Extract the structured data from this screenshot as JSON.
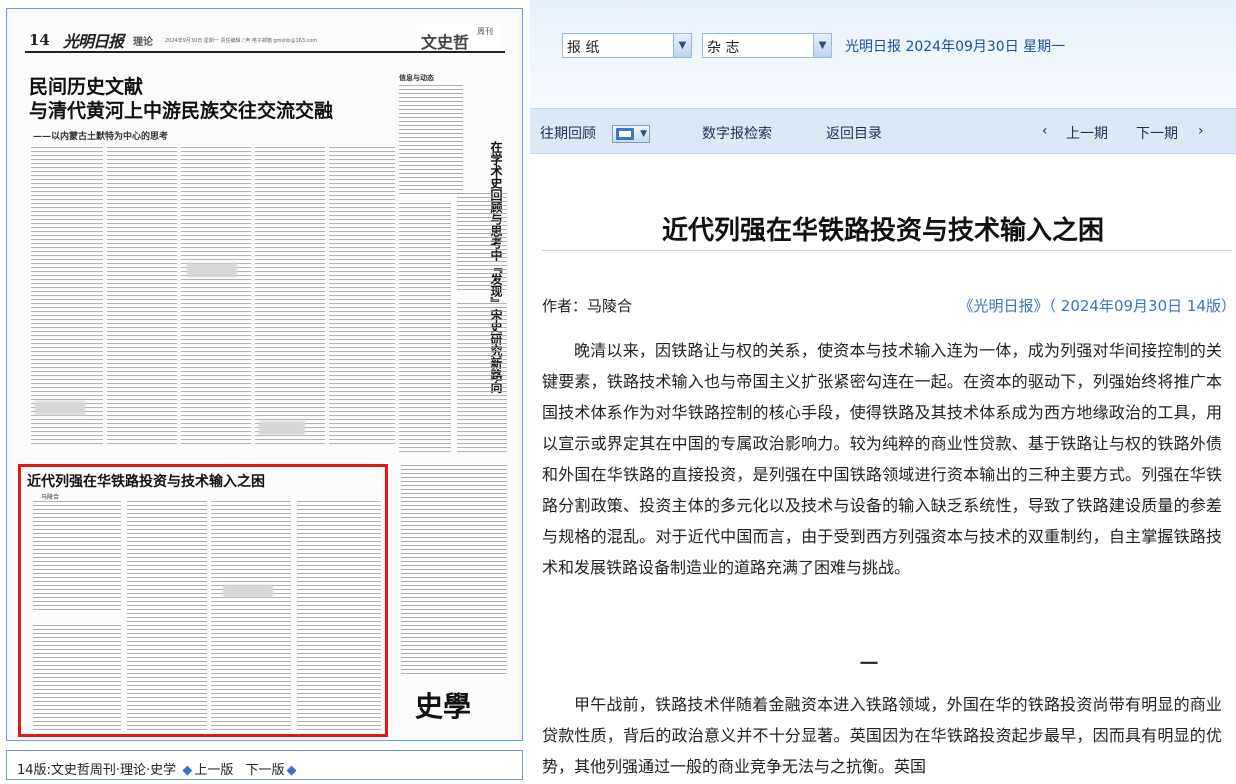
{
  "newspaper": {
    "page_num": "14",
    "logo": "光明日报",
    "section": "理论",
    "meta": "2024年9月30日 星期一 责任编辑 / 声 电子邮箱 gmshb@163.com",
    "weekly_title": "文史哲",
    "weekly_badge": "周刊",
    "headline": [
      "民间历史文献",
      "与清代黄河上中游民族交往交流交融"
    ],
    "subheadline": "——以内蒙古土默特为中心的思考",
    "column_headline": "在学术史回顾与思考中『发现』宋史研究新路向",
    "sidebar_head": "信息与动态",
    "highlight_headline": "近代列强在华铁路投资与技术输入之困",
    "highlight_author": "马陵合",
    "corner_title": "史學"
  },
  "bottom_nav": {
    "page_label": "14版:文史哲周刊·理论·史学",
    "prev": "上一版",
    "next": "下一版"
  },
  "topbar": {
    "select1": "报  纸",
    "select2": "杂  志",
    "date_label": "光明日报  2024年09月30日  星期一"
  },
  "navbar": {
    "history": "往期回顾",
    "search": "数字报检索",
    "back": "返回目录",
    "prev_issue": "上一期",
    "next_issue": "下一期"
  },
  "article": {
    "title": "近代列强在华铁路投资与技术输入之困",
    "author": "作者：马陵合",
    "source": "《光明日报》（ 2024年09月30日  14版）",
    "paragraphs": [
      "晚清以来，因铁路让与权的关系，使资本与技术输入连为一体，成为列强对华间接控制的关键要素，铁路技术输入也与帝国主义扩张紧密勾连在一起。在资本的驱动下，列强始终将推广本国技术体系作为对华铁路控制的核心手段，使得铁路及其技术体系成为西方地缘政治的工具，用以宣示或界定其在中国的专属政治影响力。较为纯粹的商业性贷款、基于铁路让与权的铁路外债和外国在华铁路的直接投资，是列强在中国铁路领域进行资本输出的三种主要方式。列强在华铁路分割政策、投资主体的多元化以及技术与设备的输入缺乏系统性，导致了铁路建设质量的参差与规格的混乱。对于近代中国而言，由于受到西方列强资本与技术的双重制约，自主掌握铁路技术和发展铁路设备制造业的道路充满了困难与挑战。",
      "甲午战前，铁路技术伴随着金融资本进入铁路领域，外国在华的铁路投资尚带有明显的商业贷款性质，背后的政治意义并不十分显著。英国因为在华铁路投资起步最早，因而具有明显的优势，其他列强通过一般的商业竞争无法与之抗衡。英国"
    ],
    "section_numeral": "一"
  }
}
